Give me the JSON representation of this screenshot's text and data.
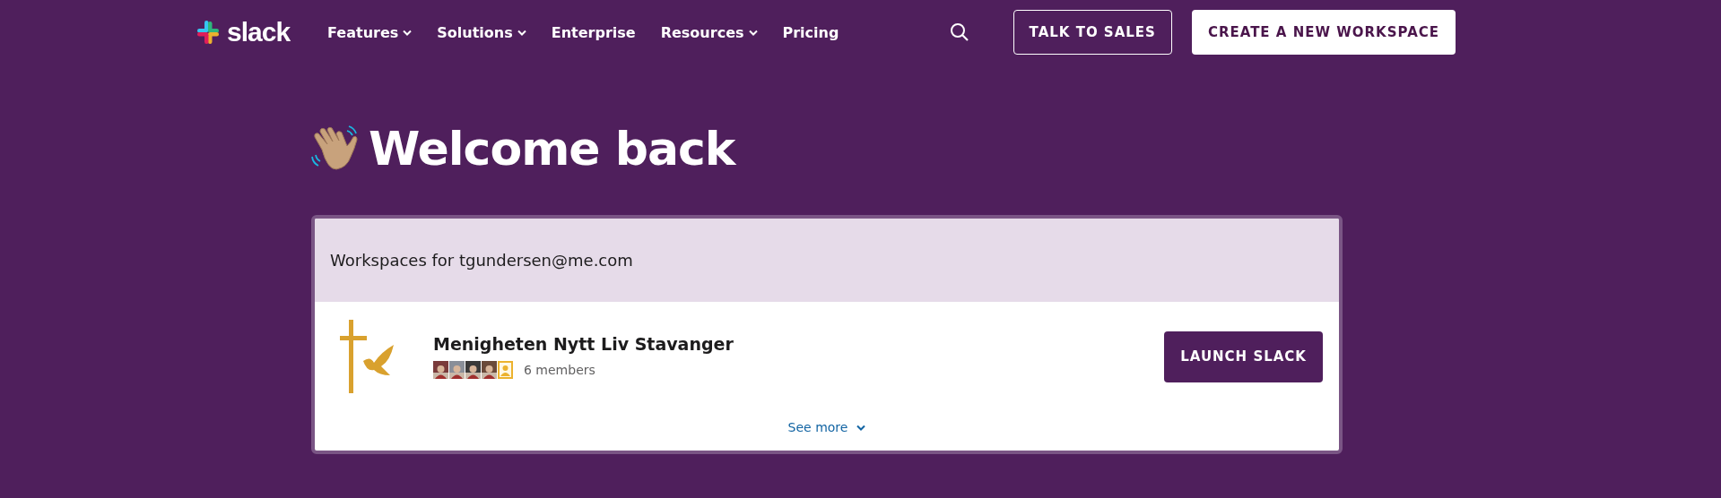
{
  "nav": {
    "logo": "slack",
    "items": [
      {
        "label": "Features",
        "has_menu": true
      },
      {
        "label": "Solutions",
        "has_menu": true
      },
      {
        "label": "Enterprise",
        "has_menu": false
      },
      {
        "label": "Resources",
        "has_menu": true
      },
      {
        "label": "Pricing",
        "has_menu": false
      }
    ],
    "talk_button": "TALK TO SALES",
    "create_button": "CREATE A NEW WORKSPACE"
  },
  "heading": "Welcome back",
  "card": {
    "header": "Workspaces for tgundersen@me.com",
    "workspaces": [
      {
        "name": "Menigheten Nytt Liv Stavanger",
        "members": "6 members",
        "avatars": [
          {
            "kind": "picture"
          },
          {
            "kind": "picture"
          },
          {
            "kind": "picture"
          },
          {
            "kind": "picture"
          },
          {
            "kind": "placeholder"
          }
        ],
        "button": "LAUNCH SLACK"
      }
    ],
    "see_more": "See more"
  }
}
